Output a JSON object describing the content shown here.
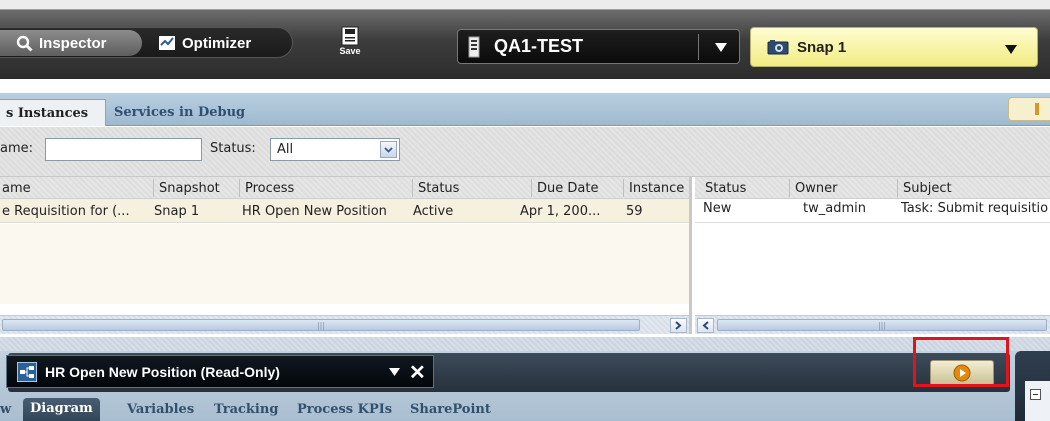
{
  "toolbar": {
    "inspector_label": "Inspector",
    "optimizer_label": "Optimizer",
    "save_label": "Save",
    "server_value": "QA1-TEST",
    "snapshot_value": "Snap 1"
  },
  "tabs": {
    "process_instances": "s Instances",
    "services_in_debug": "Services in Debug"
  },
  "filter": {
    "name_label": "ame:",
    "name_value": "",
    "status_label": "Status:",
    "status_value": "All"
  },
  "instances_grid": {
    "headers": [
      "ame",
      "Snapshot",
      "Process",
      "Status",
      "Due Date",
      "Instance"
    ],
    "rows": [
      [
        "e Requisition for (...",
        "Snap 1",
        "HR Open New Position",
        "Active",
        "Apr 1, 200...",
        "59"
      ]
    ]
  },
  "tasks_grid": {
    "headers": [
      "Status",
      "Owner",
      "Subject"
    ],
    "rows": [
      [
        "New",
        "tw_admin",
        "Task: Submit requisitio"
      ]
    ]
  },
  "editor": {
    "title": "HR Open New Position (Read-Only)",
    "subtabs": [
      "w",
      "Diagram",
      "Variables",
      "Tracking",
      "Process KPIs",
      "SharePoint"
    ]
  },
  "colors": {
    "snap_accent": "#f2eb83",
    "highlight": "#e0151c",
    "play_orange": "#e38a0d"
  }
}
